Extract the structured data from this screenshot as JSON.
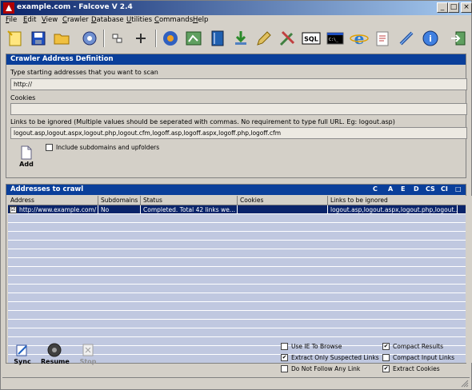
{
  "window": {
    "title": "example.com - Falcove V 2.4"
  },
  "menu": [
    "File",
    "Edit",
    "View",
    "Crawler",
    "Database",
    "Utilities",
    "Commands",
    "Help"
  ],
  "toolbar_icons": [
    "new-icon",
    "save-icon",
    "open-folder-icon",
    "settings-icon",
    "collapse-icon",
    "expand-icon",
    "spider-icon",
    "map-icon",
    "book-icon",
    "download-icon",
    "pen-icon",
    "tools-icon",
    "sql-icon",
    "console-icon",
    "ie-icon",
    "notepad-icon",
    "link-icon",
    "help-icon",
    "exit-icon"
  ],
  "toolbar_labels": {
    "sql": "SQL",
    "console": "C:\\_"
  },
  "crawler_def": {
    "header": "Crawler Address Definition",
    "start_label": "Type starting addresses that you want to scan",
    "start_value": "http://",
    "cookies_label": "Cookies",
    "cookies_value": "",
    "ignore_label": "Links to be ignored (Multiple values should be seperated with commas. No requirement to type full URL. Eg: logout.asp)",
    "ignore_value": "logout.asp,logout.aspx,logout.php,logout.cfm,logoff.asp,logoff.aspx,logoff.php,logoff.cfm",
    "add_label": "Add",
    "subdomains_label": "Include subdomains and upfolders"
  },
  "addresses": {
    "header": "Addresses to crawl",
    "filters": [
      "C",
      "A",
      "E",
      "D",
      "CS",
      "CI",
      "□"
    ],
    "columns": [
      "Address",
      "Subdomains",
      "Status",
      "Cookies",
      "Links to be ignored"
    ],
    "rows": [
      {
        "checked": "☑",
        "address": "http://www.example.com/",
        "subdomains": "No",
        "status": "Completed. Total 42 links we...",
        "cookies": "",
        "ignored": "logout.asp,logout.aspx,logout.php,logout...."
      }
    ]
  },
  "bottom": {
    "sync": "Sync",
    "resume": "Resume",
    "stop": "Stop",
    "options": [
      {
        "label": "Use IE To Browse",
        "checked": ""
      },
      {
        "label": "Extract Only Suspected Links",
        "checked": "✔"
      },
      {
        "label": "Do Not Follow Any Link",
        "checked": ""
      },
      {
        "label": "Compact Results",
        "checked": "✔"
      },
      {
        "label": "Compact Input Links",
        "checked": ""
      },
      {
        "label": "Extract Cookies",
        "checked": "✔"
      }
    ]
  },
  "colors": {
    "header_blue": "#0a3f9a",
    "selected_row": "#0a246a",
    "table_bg": "#c0c8e0"
  }
}
